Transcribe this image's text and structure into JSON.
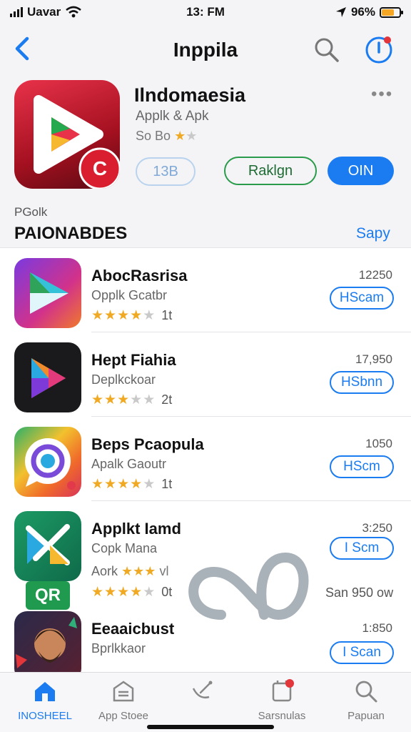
{
  "status_bar": {
    "carrier": "Uavar",
    "time": "13: FM",
    "battery": "96%",
    "battery_level": 0.7
  },
  "nav": {
    "title": "Inppila"
  },
  "featured": {
    "title": "Ilndomaesia",
    "subtitle": "Applk & Apk",
    "rating_text": "So Bo",
    "more": "•••",
    "btn_outline_label": "13B",
    "btn_secondary_label": "Raklgn",
    "btn_primary_label": "OIN"
  },
  "section": {
    "small": "PGolk",
    "title": "PAIONABDES",
    "link": "Sapy"
  },
  "apps": [
    {
      "name": "AbocRasrisa",
      "developer": "Opplk Gcatbr",
      "stars": 4,
      "count": "1t",
      "price": "12250",
      "button": "HScam"
    },
    {
      "name": "Hept Fiahia",
      "developer": "Deplkckoar",
      "stars": 3,
      "count": "2t",
      "price": "17,950",
      "button": "HSbnn"
    },
    {
      "name": "Beps Pcaopula",
      "developer": "Apalk Gaoutr",
      "stars": 4,
      "count": "1t",
      "price": "1050",
      "button": "HScm"
    },
    {
      "name": "Applkt Iamd",
      "developer": "Copk Mana",
      "developer2": "Aork",
      "stars": 4,
      "count": "0t",
      "price": "3:250",
      "button": "I Scm",
      "extra": "San 950 ow"
    },
    {
      "name": "Eeaaicbust",
      "developer": "Bprlkkaor",
      "stars": 0,
      "count": "",
      "price": "1:850",
      "button": "I Scan"
    }
  ],
  "badge": "QR",
  "tabs": [
    {
      "label": "INOSHEEL",
      "icon": "home-icon",
      "active": true
    },
    {
      "label": "App Stoee",
      "icon": "list-icon",
      "active": false
    },
    {
      "label": "",
      "icon": "satellite-icon",
      "active": false
    },
    {
      "label": "Sarsnulas",
      "icon": "updates-icon",
      "active": false
    },
    {
      "label": "Papuan",
      "icon": "search-icon",
      "active": false
    }
  ],
  "colors": {
    "accent": "#1a7cf0",
    "star": "#f0a922",
    "green": "#2a9b4a"
  }
}
